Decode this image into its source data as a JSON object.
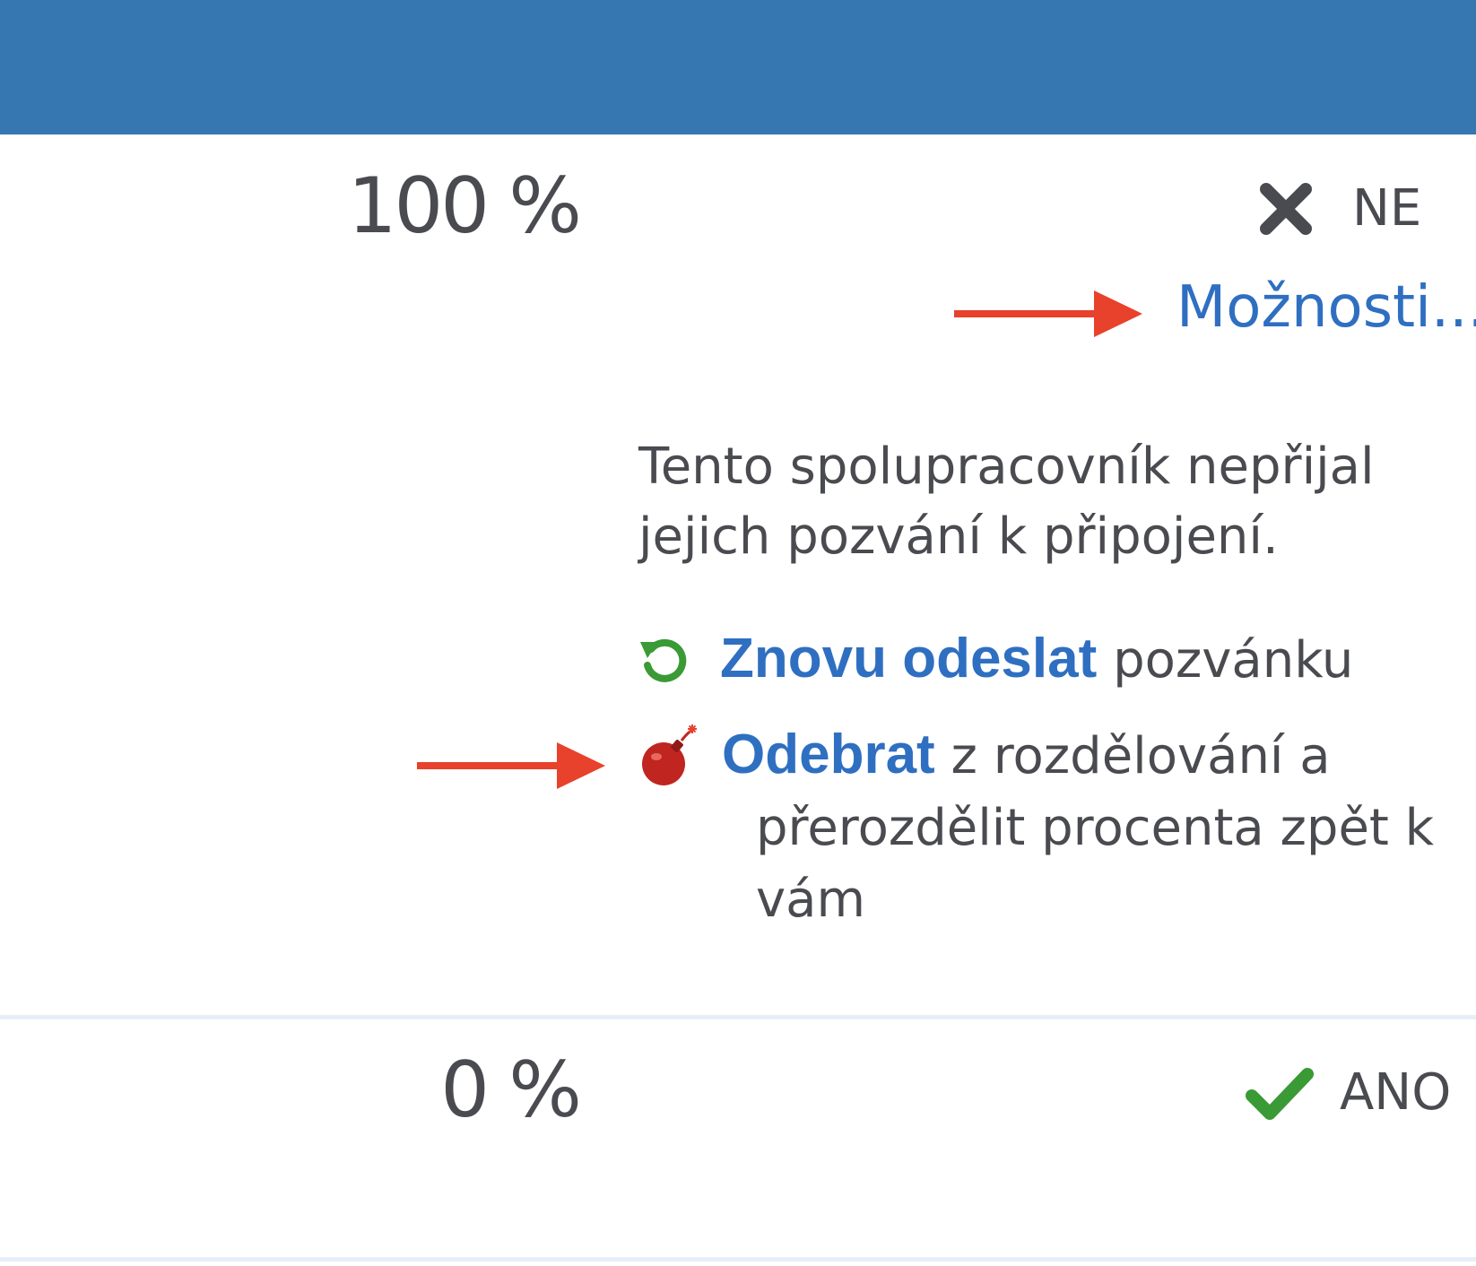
{
  "rows": [
    {
      "percent": "100 %",
      "accepted_label": "NE",
      "accepted_icon": "x-icon",
      "options_link": "Možnosti...",
      "message_line1": "Tento spolupracovník nepřijal",
      "message_line2": "jejich pozvání k připojení.",
      "resend": {
        "icon": "refresh-icon",
        "link": "Znovu odeslat",
        "suffix": " pozvánku"
      },
      "remove": {
        "icon": "bomb-icon",
        "link": "Odebrat",
        "suffix_line1": " z rozdělování a",
        "suffix_line2": "přerozdělit procenta zpět k",
        "suffix_line3": "vám"
      }
    },
    {
      "percent": "0 %",
      "accepted_label": "ANO",
      "accepted_icon": "check-icon"
    }
  ],
  "colors": {
    "header": "#3677b2",
    "link": "#2f6fc1",
    "text": "#4a4b50",
    "annotation_arrow": "#e8412c",
    "check": "#3a9a35",
    "refresh": "#3a9a35",
    "bomb": "#c0251f",
    "divider": "#e6eff8"
  }
}
